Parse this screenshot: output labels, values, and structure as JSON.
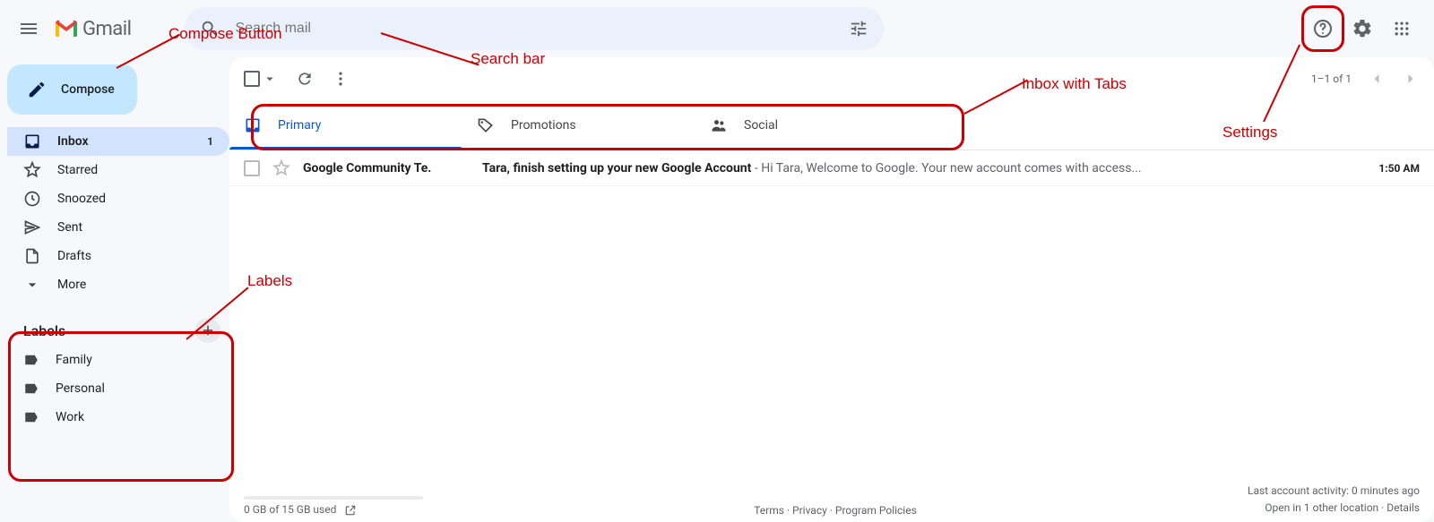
{
  "header": {
    "logo_text": "Gmail",
    "search_placeholder": "Search mail"
  },
  "compose_label": "Compose",
  "nav": [
    {
      "label": "Inbox",
      "count": "1",
      "active": true
    },
    {
      "label": "Starred"
    },
    {
      "label": "Snoozed"
    },
    {
      "label": "Sent"
    },
    {
      "label": "Drafts"
    },
    {
      "label": "More"
    }
  ],
  "labels_header": "Labels",
  "labels": [
    {
      "name": "Family"
    },
    {
      "name": "Personal"
    },
    {
      "name": "Work"
    }
  ],
  "toolbar": {
    "page_info": "1–1 of 1"
  },
  "tabs": [
    {
      "label": "Primary",
      "active": true
    },
    {
      "label": "Promotions"
    },
    {
      "label": "Social"
    }
  ],
  "emails": [
    {
      "sender": "Google Community Te.",
      "subject": "Tara, finish setting up your new Google Account",
      "preview_sep": " - ",
      "preview": "Hi Tara, Welcome to Google. Your new account comes with access...",
      "time": "1:50 AM"
    }
  ],
  "footer": {
    "storage": "0 GB of 15 GB used",
    "terms": "Terms",
    "privacy": "Privacy",
    "policies": "Program Policies",
    "activity": "Last account activity: 0 minutes ago",
    "open_in": "Open in 1 other location",
    "details": "Details"
  },
  "annotations": {
    "compose": "Compose Button",
    "search": "Search bar",
    "tabs": "Inbox with Tabs",
    "settings": "Settings",
    "labels": "Labels"
  }
}
